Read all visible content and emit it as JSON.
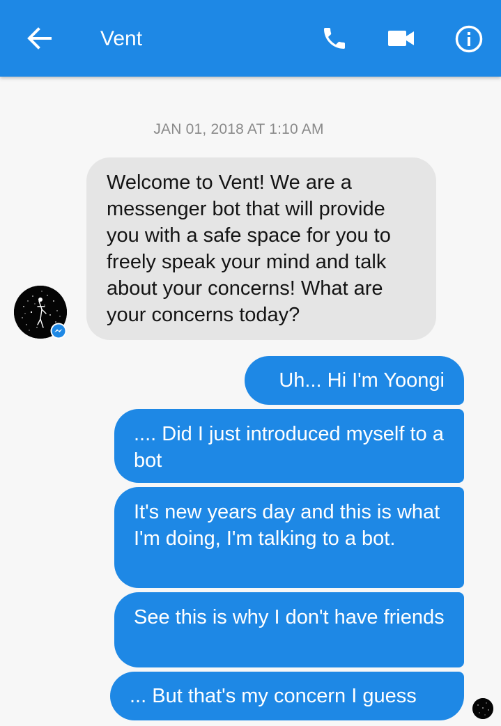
{
  "app_bar": {
    "title": "Vent",
    "color": "#1e88e5",
    "icons": [
      "back-arrow-icon",
      "phone-icon",
      "video-camera-icon",
      "info-icon"
    ]
  },
  "conversation": {
    "timestamp": "JAN 01, 2018 AT 1:10 AM",
    "incoming": [
      {
        "text": "Welcome to Vent! We are a messenger bot that will provide you with a safe space for you to freely speak your mind and talk about your concerns! What are your concerns today?",
        "bubble_color": "#e5e5e5"
      }
    ],
    "outgoing": [
      {
        "text": "Uh... Hi I'm Yoongi"
      },
      {
        "text": ".... Did I just introduced myself to a bot"
      },
      {
        "text": "It's new years day and this is what I'm doing, I'm talking to a bot."
      },
      {
        "text": "See this is why I don't have friends"
      },
      {
        "text": "... But that's my concern I guess"
      }
    ],
    "outgoing_bubble_color": "#1e88e5"
  }
}
